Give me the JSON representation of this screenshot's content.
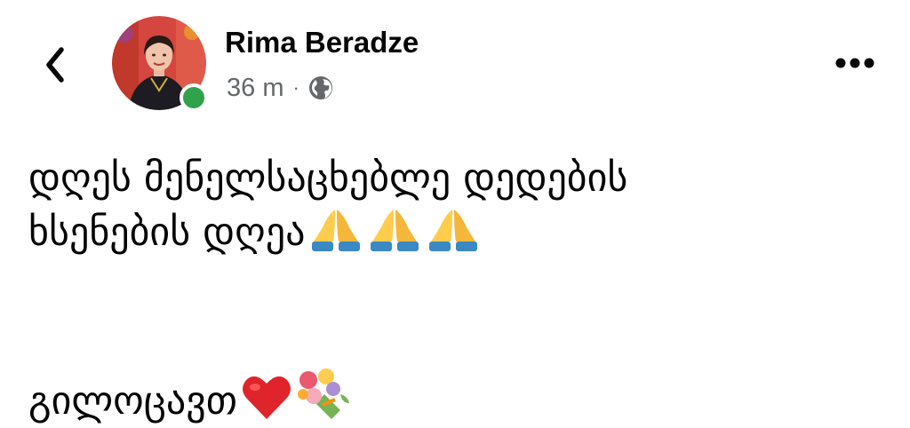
{
  "header": {
    "back_icon": "chevron-left-icon",
    "author_name": "Rima Beradze",
    "timestamp": "36 m",
    "separator": "·",
    "privacy_icon": "globe-icon",
    "more_icon": "more-horizontal-icon",
    "online_status_color": "#31a24c"
  },
  "post": {
    "line1": "დღეს მენელსაცხებლე დედების",
    "line2": "ხსენების დღეა",
    "line2_emojis": [
      "folded-hands-emoji",
      "folded-hands-emoji",
      "folded-hands-emoji"
    ],
    "line3": "გილოცავთ",
    "line3_emojis": [
      "red-heart-emoji",
      "bouquet-emoji"
    ]
  },
  "colors": {
    "text_primary": "#050505",
    "text_secondary": "#65676b",
    "online": "#31a24c"
  }
}
